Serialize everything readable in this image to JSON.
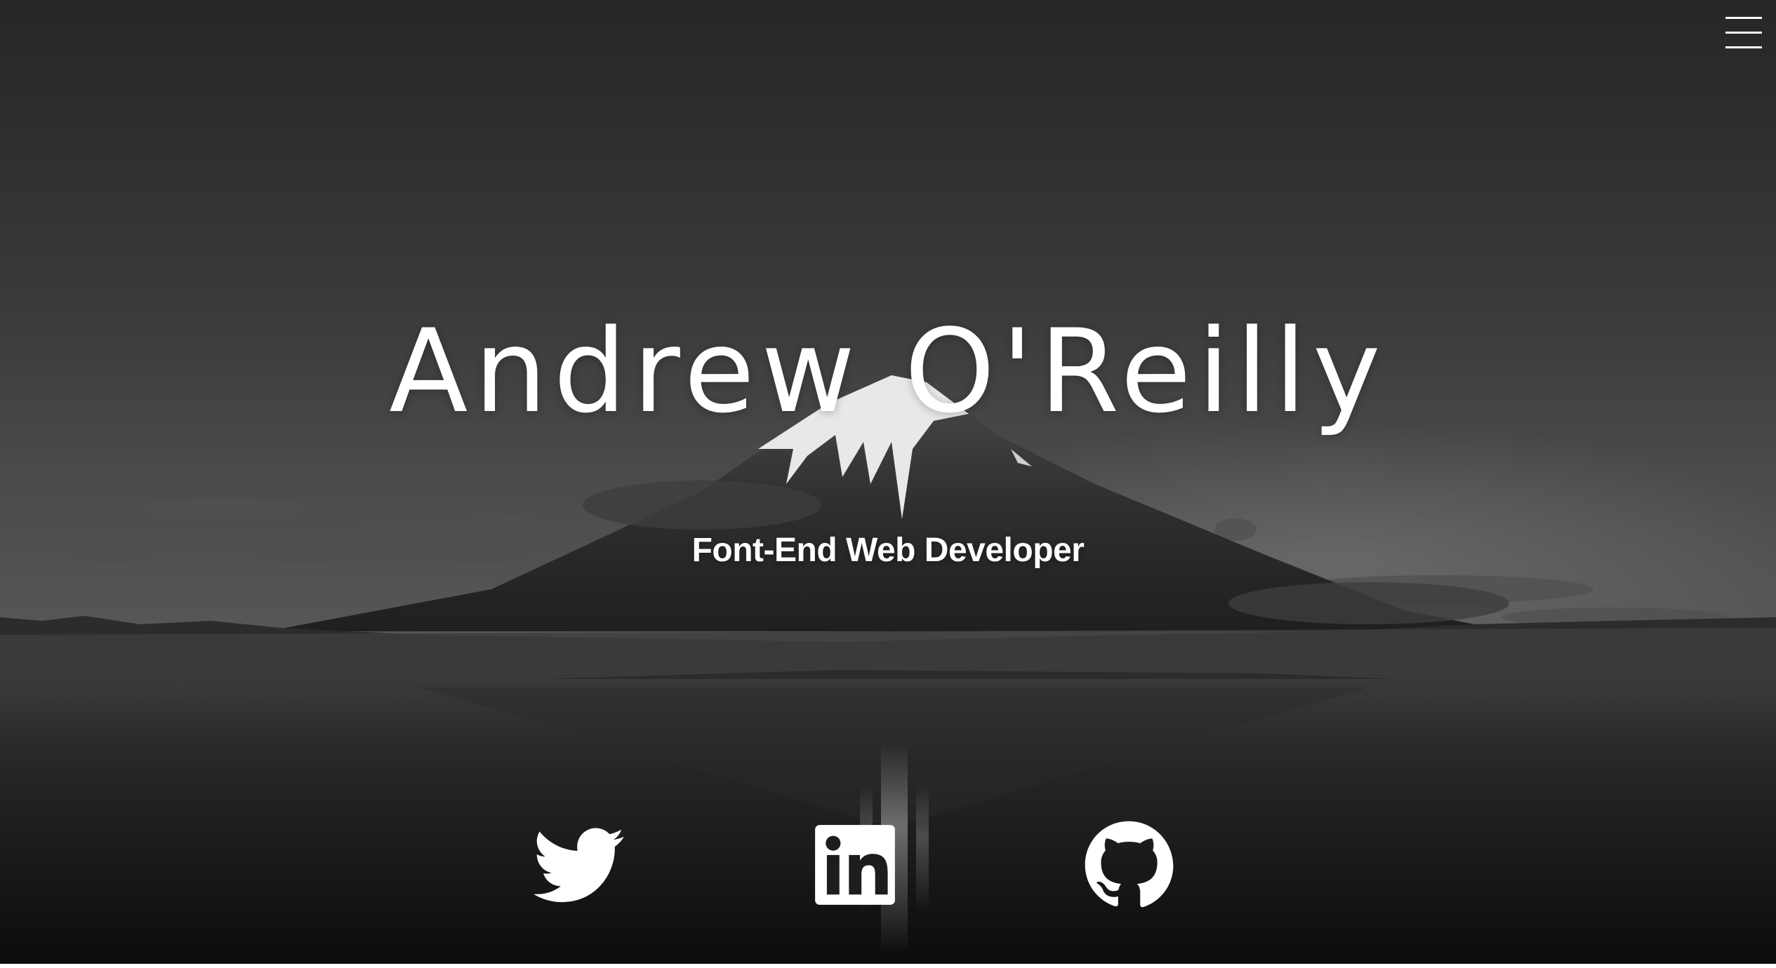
{
  "hero": {
    "name": "Andrew O'Reilly",
    "role": "Font-End Web Developer"
  },
  "navigation": {
    "menu_icon": "hamburger-menu-icon"
  },
  "social_links": [
    {
      "icon": "twitter-icon"
    },
    {
      "icon": "linkedin-icon"
    },
    {
      "icon": "github-icon"
    }
  ],
  "colors": {
    "text": "#ffffff",
    "sky": "#2a2a2a",
    "water": "#141414"
  }
}
